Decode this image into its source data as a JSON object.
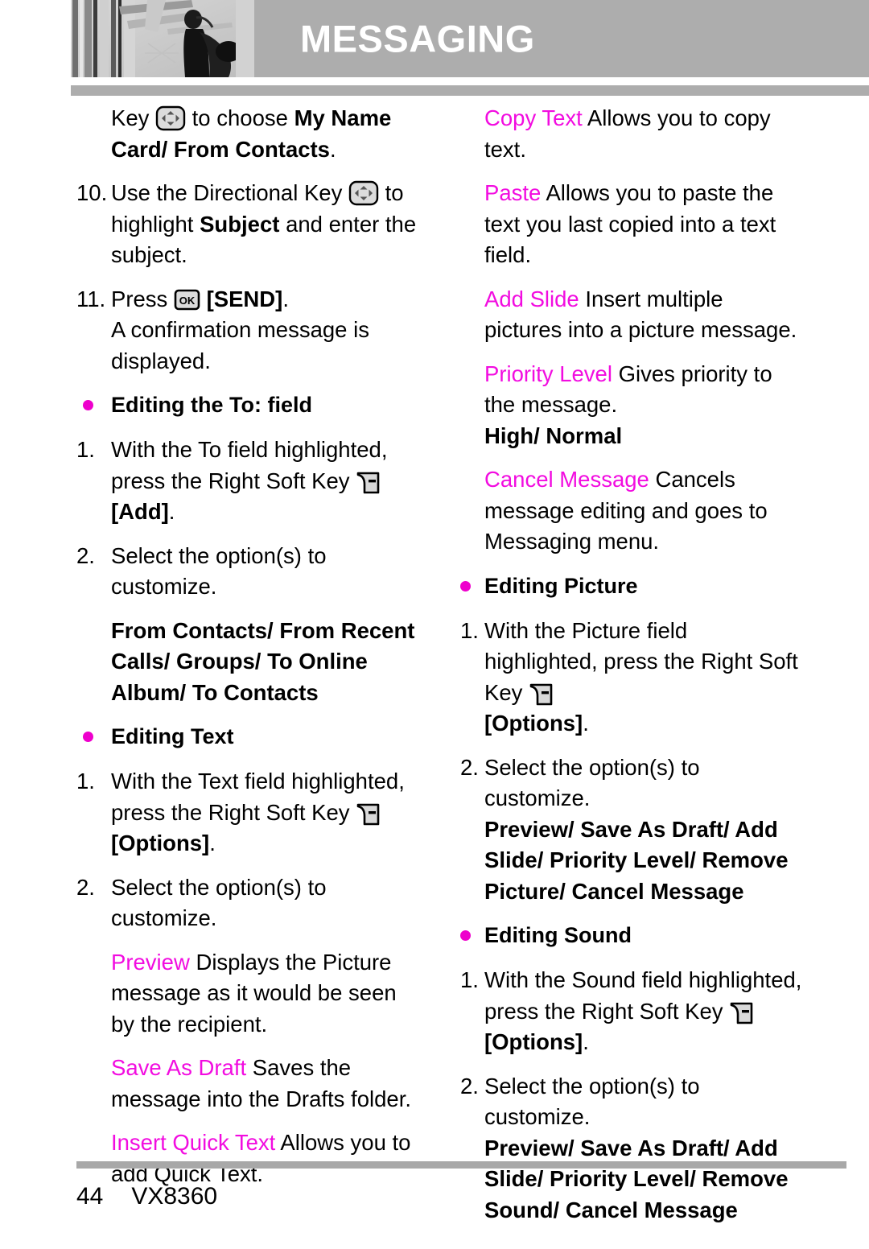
{
  "header": {
    "title": "MESSAGING",
    "photo_alt": "grayscale photo of person with vertical rails"
  },
  "colors": {
    "accent_magenta": "#F20CE0",
    "bullet_magenta": "#EE00CC",
    "header_gray": "#ADADAD",
    "rule_gray": "#A8A8A8"
  },
  "left_column": {
    "cont_step9": {
      "lead": "Key",
      "mid": "to choose",
      "bold": "My Name Card/ From Contacts",
      "tail": "."
    },
    "step10": {
      "num": "10.",
      "part1": "Use the Directional Key",
      "part2": "to highlight",
      "bold": "Subject",
      "part3": "and enter the subject."
    },
    "step11": {
      "num": "11.",
      "part1": "Press",
      "bold": "[SEND]",
      "tail": ".",
      "part2": "A confirmation message is displayed."
    },
    "section_to_field": {
      "heading": "Editing the To: field",
      "step1": {
        "num": "1.",
        "part1": "With the To field highlighted, press the Right Soft Key",
        "bold": "[Add]",
        "tail": "."
      },
      "step2": {
        "num": "2.",
        "text": "Select the option(s) to customize."
      },
      "options": "From Contacts/ From Recent Calls/ Groups/ To Online Album/ To Contacts"
    },
    "section_editing_text": {
      "heading": "Editing Text",
      "step1": {
        "num": "1.",
        "part1": "With the Text field highlighted, press the Right Soft Key",
        "bold": "[Options]",
        "tail": "."
      },
      "step2": {
        "num": "2.",
        "text": "Select the option(s) to customize."
      },
      "definitions": [
        {
          "term": "Preview",
          "desc": "Displays the Picture message as it would be seen by the recipient."
        },
        {
          "term": "Save As Draft",
          "desc": "Saves the message into the Drafts folder."
        },
        {
          "term": "Insert Quick Text",
          "desc": "Allows you to add Quick Text."
        }
      ]
    }
  },
  "right_column": {
    "definitions_top": [
      {
        "term": "Copy Text",
        "desc": "Allows you to copy text."
      },
      {
        "term": "Paste",
        "desc": "Allows you to paste the text you last copied into a text field."
      },
      {
        "term": "Add Slide",
        "desc": "Insert multiple pictures into a picture message."
      },
      {
        "term": "Priority Level",
        "desc": "Gives priority to the message."
      }
    ],
    "priority_values": "High/ Normal",
    "cancel_message": {
      "term": "Cancel Message",
      "desc": "Cancels message editing and goes to Messaging menu."
    },
    "section_editing_picture": {
      "heading": "Editing Picture",
      "step1": {
        "num": "1.",
        "part1": "With the Picture field highlighted, press the Right Soft Key",
        "bold": "[Options]",
        "tail": "."
      },
      "step2": {
        "num": "2.",
        "text": "Select the option(s) to customize."
      },
      "options": "Preview/ Save As Draft/ Add Slide/ Priority Level/ Remove Picture/ Cancel Message"
    },
    "section_editing_sound": {
      "heading": "Editing Sound",
      "step1": {
        "num": "1.",
        "part1": "With the Sound field highlighted, press the Right Soft Key",
        "bold": "[Options]",
        "tail": "."
      },
      "step2": {
        "num": "2.",
        "text": "Select the option(s) to customize."
      },
      "options": "Preview/ Save As Draft/ Add Slide/ Priority Level/ Remove Sound/ Cancel Message"
    }
  },
  "footer": {
    "page_number": "44",
    "model": "VX8360"
  },
  "icons": {
    "dpad": "directional-key-icon",
    "ok": "ok-key-icon",
    "softkey": "right-soft-key-icon"
  }
}
